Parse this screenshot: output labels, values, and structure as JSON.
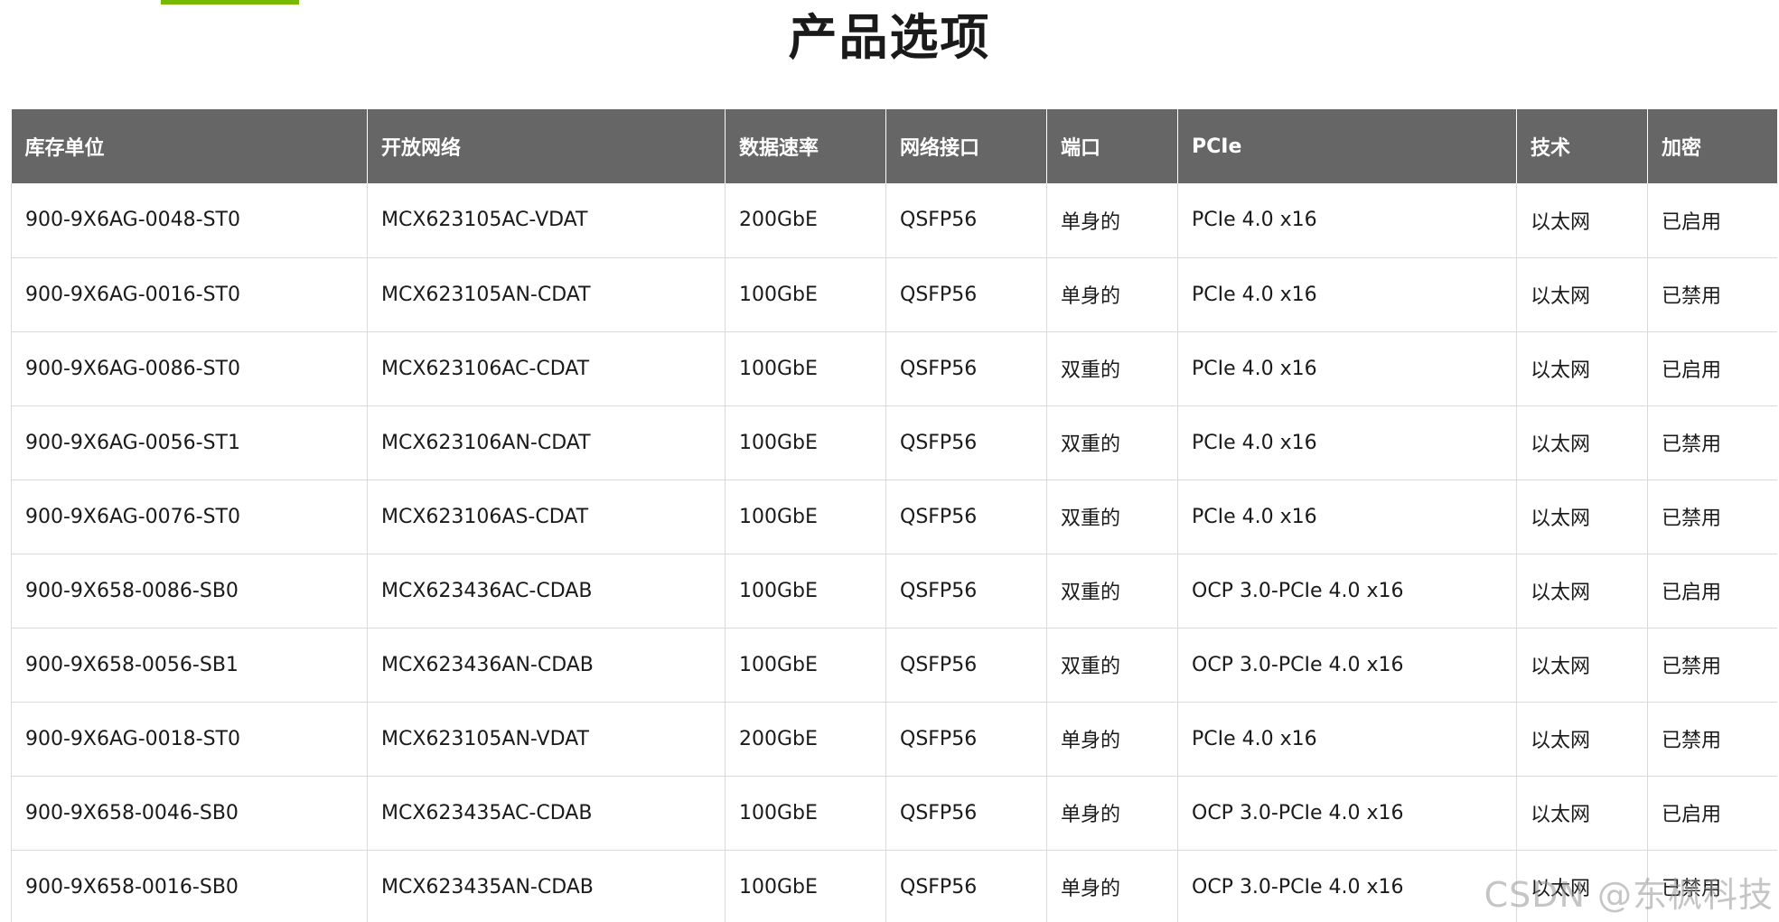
{
  "title": "产品选项",
  "colors": {
    "accent": "#76b900",
    "header_bg": "#666666",
    "header_text": "#ffffff",
    "border": "#d9d9d9"
  },
  "table": {
    "headers": [
      "库存单位",
      "开放网络",
      "数据速率",
      "网络接口",
      "端口",
      "PCIe",
      "技术",
      "加密"
    ],
    "rows": [
      [
        "900-9X6AG-0048-ST0",
        "MCX623105AC-VDAT",
        "200GbE",
        "QSFP56",
        "单身的",
        "PCIe 4.0 x16",
        "以太网",
        "已启用"
      ],
      [
        "900-9X6AG-0016-ST0",
        "MCX623105AN-CDAT",
        "100GbE",
        "QSFP56",
        "单身的",
        "PCIe 4.0 x16",
        "以太网",
        "已禁用"
      ],
      [
        "900-9X6AG-0086-ST0",
        "MCX623106AC-CDAT",
        "100GbE",
        "QSFP56",
        "双重的",
        "PCIe 4.0 x16",
        "以太网",
        "已启用"
      ],
      [
        "900-9X6AG-0056-ST1",
        "MCX623106AN-CDAT",
        "100GbE",
        "QSFP56",
        "双重的",
        "PCIe 4.0 x16",
        "以太网",
        "已禁用"
      ],
      [
        "900-9X6AG-0076-ST0",
        "MCX623106AS-CDAT",
        "100GbE",
        "QSFP56",
        "双重的",
        "PCIe 4.0 x16",
        "以太网",
        "已禁用"
      ],
      [
        "900-9X658-0086-SB0",
        "MCX623436AC-CDAB",
        "100GbE",
        "QSFP56",
        "双重的",
        "OCP 3.0-PCIe 4.0 x16",
        "以太网",
        "已启用"
      ],
      [
        "900-9X658-0056-SB1",
        "MCX623436AN-CDAB",
        "100GbE",
        "QSFP56",
        "双重的",
        "OCP 3.0-PCIe 4.0 x16",
        "以太网",
        "已禁用"
      ],
      [
        "900-9X6AG-0018-ST0",
        "MCX623105AN-VDAT",
        "200GbE",
        "QSFP56",
        "单身的",
        "PCIe 4.0 x16",
        "以太网",
        "已禁用"
      ],
      [
        "900-9X658-0046-SB0",
        "MCX623435AC-CDAB",
        "100GbE",
        "QSFP56",
        "单身的",
        "OCP 3.0-PCIe 4.0 x16",
        "以太网",
        "已启用"
      ],
      [
        "900-9X658-0016-SB0",
        "MCX623435AN-CDAB",
        "100GbE",
        "QSFP56",
        "单身的",
        "OCP 3.0-PCIe 4.0 x16",
        "以太网",
        "已禁用"
      ]
    ]
  },
  "watermark": "CSDN @东枫科技"
}
